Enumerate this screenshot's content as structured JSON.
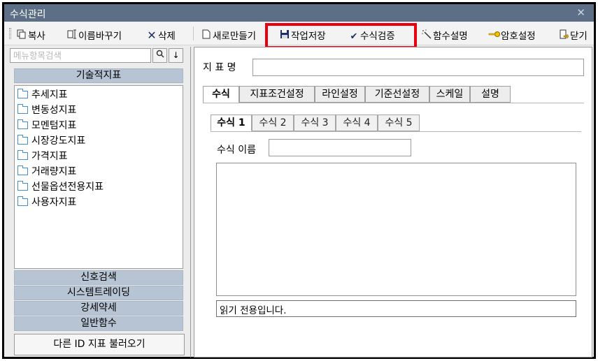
{
  "window": {
    "title": "수식관리",
    "close_glyph": "✕"
  },
  "toolbar": {
    "copy": {
      "label": "복사",
      "icon": "copy-icon"
    },
    "rename": {
      "label": "이름바꾸기",
      "icon": "rename-icon"
    },
    "delete": {
      "label": "삭제",
      "icon": "x-icon"
    },
    "new": {
      "label": "새로만들기",
      "icon": "new-document-icon"
    },
    "save": {
      "label": "작업저장",
      "icon": "floppy-disk-icon"
    },
    "verify": {
      "label": "수식검증",
      "icon": "checkmark-icon"
    },
    "function_help": {
      "label": "함수설명",
      "icon": "magic-wand-icon"
    },
    "password": {
      "label": "암호설정",
      "icon": "key-icon"
    },
    "close": {
      "label": "닫기",
      "icon": "exit-door-icon"
    },
    "highlight_color": "#e8000f"
  },
  "sidebar": {
    "search_placeholder": "메뉴항목검색",
    "search_icon_glyph": "🔍",
    "down_glyph": "↓",
    "categories": {
      "technical": "기술적지표",
      "signal_search": "신호검색",
      "system_trading": "시스템트레이딩",
      "strength": "강세약세",
      "general_functions": "일반함수"
    },
    "tree_items": [
      "추세지표",
      "변동성지표",
      "모멘텀지표",
      "시장강도지표",
      "가격지표",
      "거래량지표",
      "선물옵션전용지표",
      "사용자지표"
    ],
    "load_button": "다른 ID 지표 불러오기"
  },
  "main": {
    "indicator_name_label": "지 표 명",
    "indicator_name_value": "",
    "tabs": [
      "수식",
      "지표조건설정",
      "라인설정",
      "기준선설정",
      "스케일",
      "설명"
    ],
    "active_tab": "수식",
    "formula_tabs": [
      "수식 1",
      "수식 2",
      "수식 3",
      "수식 4",
      "수식 5"
    ],
    "formula_name_label": "수식 이름",
    "formula_name_value": "",
    "formula_text": "",
    "status_text": "읽기 전용입니다."
  },
  "colors": {
    "titlebar": "#5c6f86",
    "category_header": "#b7c4d4",
    "folder_icon": "#3f8fd2"
  }
}
